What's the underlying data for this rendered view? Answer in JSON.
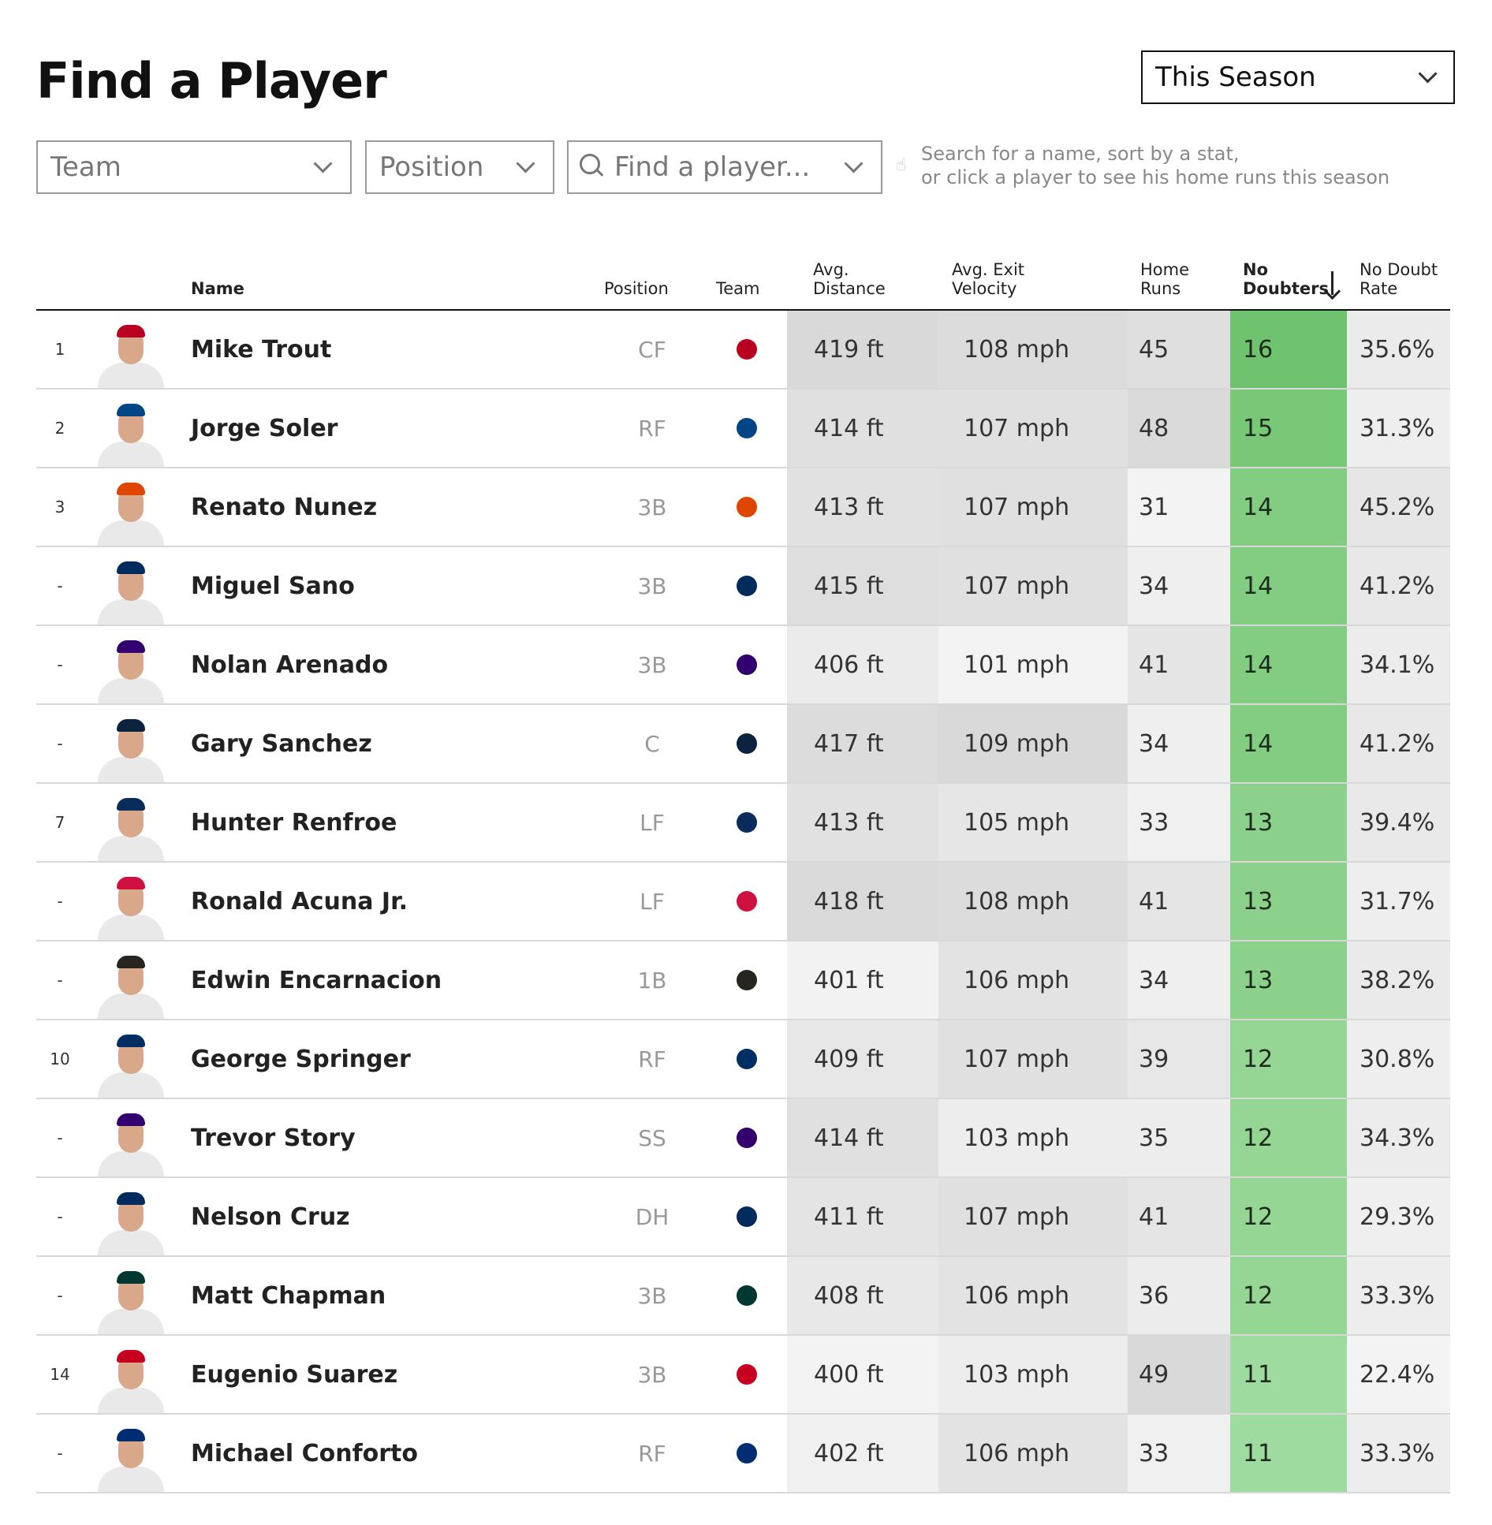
{
  "header": {
    "title": "Find a Player",
    "season_select": "This Season"
  },
  "filters": {
    "team": "Team",
    "position": "Position",
    "search_placeholder": "Find a player...",
    "hint_line1": "Search for a name, sort by a stat,",
    "hint_line2": "or click a player to see his home runs this season"
  },
  "table": {
    "columns": {
      "name": "Name",
      "position": "Position",
      "team": "Team",
      "avg_distance_1": "Avg.",
      "avg_distance_2": "Distance",
      "avg_ev_1": "Avg. Exit",
      "avg_ev_2": "Velocity",
      "hr_1": "Home",
      "hr_2": "Runs",
      "nd_1": "No",
      "nd_2": "Doubters",
      "ndr_1": "No Doubt",
      "ndr_2": "Rate"
    },
    "sorted_column": "No Doubters",
    "sort_direction": "descending",
    "rows": [
      {
        "rank": "1",
        "name": "Mike Trout",
        "position": "CF",
        "team_icon": "angels-logo-icon",
        "team_color": "#ba0021",
        "distance": "419 ft",
        "exit_velocity": "108 mph",
        "home_runs": "45",
        "no_doubters": "16",
        "no_doubt_rate": "35.6%"
      },
      {
        "rank": "2",
        "name": "Jorge Soler",
        "position": "RF",
        "team_icon": "royals-logo-icon",
        "team_color": "#004687",
        "distance": "414 ft",
        "exit_velocity": "107 mph",
        "home_runs": "48",
        "no_doubters": "15",
        "no_doubt_rate": "31.3%"
      },
      {
        "rank": "3",
        "name": "Renato Nunez",
        "position": "3B",
        "team_icon": "orioles-logo-icon",
        "team_color": "#df4601",
        "distance": "413 ft",
        "exit_velocity": "107 mph",
        "home_runs": "31",
        "no_doubters": "14",
        "no_doubt_rate": "45.2%"
      },
      {
        "rank": "-",
        "name": "Miguel Sano",
        "position": "3B",
        "team_icon": "twins-logo-icon",
        "team_color": "#002b5c",
        "distance": "415 ft",
        "exit_velocity": "107 mph",
        "home_runs": "34",
        "no_doubters": "14",
        "no_doubt_rate": "41.2%"
      },
      {
        "rank": "-",
        "name": "Nolan Arenado",
        "position": "3B",
        "team_icon": "rockies-logo-icon",
        "team_color": "#33006f",
        "distance": "406 ft",
        "exit_velocity": "101 mph",
        "home_runs": "41",
        "no_doubters": "14",
        "no_doubt_rate": "34.1%"
      },
      {
        "rank": "-",
        "name": "Gary Sanchez",
        "position": "C",
        "team_icon": "yankees-logo-icon",
        "team_color": "#0c2340",
        "distance": "417 ft",
        "exit_velocity": "109 mph",
        "home_runs": "34",
        "no_doubters": "14",
        "no_doubt_rate": "41.2%"
      },
      {
        "rank": "7",
        "name": "Hunter Renfroe",
        "position": "LF",
        "team_icon": "rays-logo-icon",
        "team_color": "#092c5c",
        "distance": "413 ft",
        "exit_velocity": "105 mph",
        "home_runs": "33",
        "no_doubters": "13",
        "no_doubt_rate": "39.4%"
      },
      {
        "rank": "-",
        "name": "Ronald Acuna Jr.",
        "position": "LF",
        "team_icon": "braves-logo-icon",
        "team_color": "#ce1141",
        "distance": "418 ft",
        "exit_velocity": "108 mph",
        "home_runs": "41",
        "no_doubters": "13",
        "no_doubt_rate": "31.7%"
      },
      {
        "rank": "-",
        "name": "Edwin Encarnacion",
        "position": "1B",
        "team_icon": "white-sox-logo-icon",
        "team_color": "#27251f",
        "distance": "401 ft",
        "exit_velocity": "106 mph",
        "home_runs": "34",
        "no_doubters": "13",
        "no_doubt_rate": "38.2%"
      },
      {
        "rank": "10",
        "name": "George Springer",
        "position": "RF",
        "team_icon": "astros-logo-icon",
        "team_color": "#002d62",
        "distance": "409 ft",
        "exit_velocity": "107 mph",
        "home_runs": "39",
        "no_doubters": "12",
        "no_doubt_rate": "30.8%"
      },
      {
        "rank": "-",
        "name": "Trevor Story",
        "position": "SS",
        "team_icon": "rockies-logo-icon",
        "team_color": "#33006f",
        "distance": "414 ft",
        "exit_velocity": "103 mph",
        "home_runs": "35",
        "no_doubters": "12",
        "no_doubt_rate": "34.3%"
      },
      {
        "rank": "-",
        "name": "Nelson Cruz",
        "position": "DH",
        "team_icon": "twins-logo-icon",
        "team_color": "#002b5c",
        "distance": "411 ft",
        "exit_velocity": "107 mph",
        "home_runs": "41",
        "no_doubters": "12",
        "no_doubt_rate": "29.3%"
      },
      {
        "rank": "-",
        "name": "Matt Chapman",
        "position": "3B",
        "team_icon": "athletics-logo-icon",
        "team_color": "#003831",
        "distance": "408 ft",
        "exit_velocity": "106 mph",
        "home_runs": "36",
        "no_doubters": "12",
        "no_doubt_rate": "33.3%"
      },
      {
        "rank": "14",
        "name": "Eugenio Suarez",
        "position": "3B",
        "team_icon": "reds-logo-icon",
        "team_color": "#c6011f",
        "distance": "400 ft",
        "exit_velocity": "103 mph",
        "home_runs": "49",
        "no_doubters": "11",
        "no_doubt_rate": "22.4%"
      },
      {
        "rank": "-",
        "name": "Michael Conforto",
        "position": "RF",
        "team_icon": "mets-logo-icon",
        "team_color": "#002d72",
        "distance": "402 ft",
        "exit_velocity": "106 mph",
        "home_runs": "33",
        "no_doubters": "11",
        "no_doubt_rate": "33.3%"
      }
    ]
  },
  "colors": {
    "accent_green": "#6fc36f",
    "header_rule": "#111111",
    "row_divider": "#d8d8d8"
  }
}
